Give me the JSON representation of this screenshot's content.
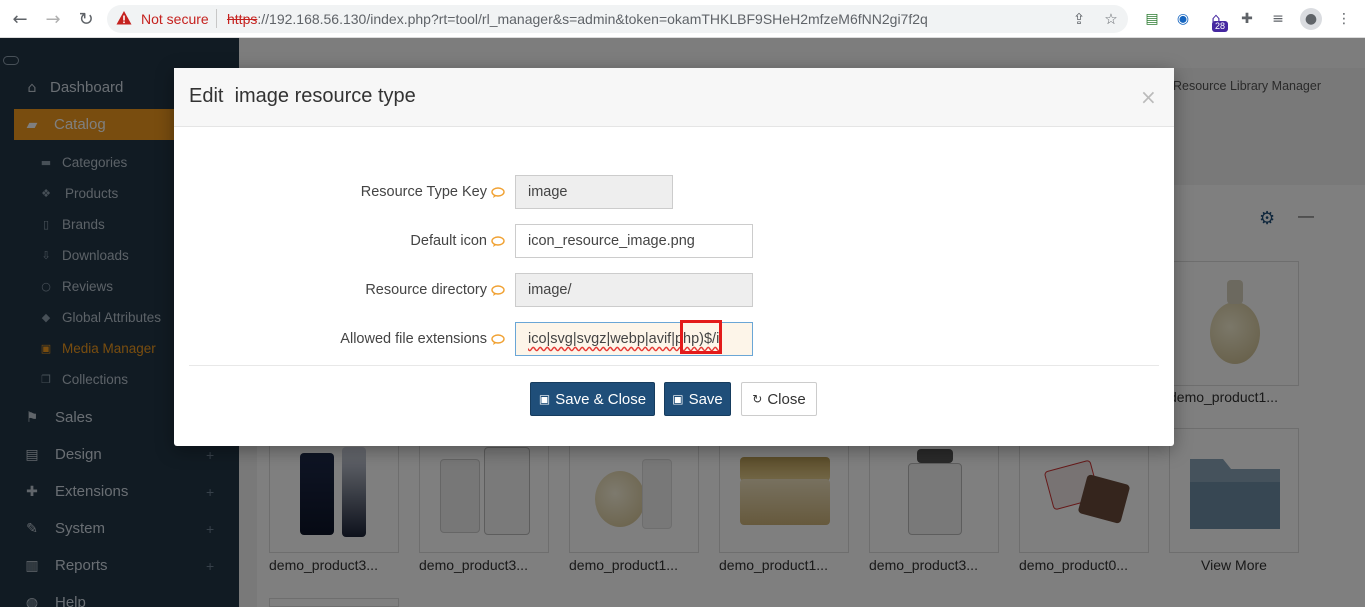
{
  "browser": {
    "back_icon": "back-arrow-icon",
    "forward_icon": "forward-arrow-icon",
    "reload_icon": "reload-icon",
    "not_secure_label": "Not secure",
    "url_scheme": "https",
    "url_rest": "://192.168.56.130/index.php?rt=tool/rl_manager&s=admin&token=okamTHKLBF9SHeH2mfzeM6fNN2gi7f2q",
    "extension_badge": "28"
  },
  "sidebar": {
    "items": [
      {
        "label": "Dashboard",
        "icon": "home-icon"
      },
      {
        "label": "Catalog",
        "icon": "folder-open-icon"
      },
      {
        "label": "Sales",
        "icon": "flag-icon"
      },
      {
        "label": "Design",
        "icon": "file-icon"
      },
      {
        "label": "Extensions",
        "icon": "puzzle-icon"
      },
      {
        "label": "System",
        "icon": "wrench-icon"
      },
      {
        "label": "Reports",
        "icon": "bar-chart-icon"
      },
      {
        "label": "Help",
        "icon": "globe-icon"
      }
    ],
    "sub_items": [
      {
        "label": "Categories",
        "icon": "folder-icon"
      },
      {
        "label": "Products",
        "icon": "cubes-icon"
      },
      {
        "label": "Brands",
        "icon": "bookmark-icon"
      },
      {
        "label": "Downloads",
        "icon": "download-icon"
      },
      {
        "label": "Reviews",
        "icon": "comment-icon"
      },
      {
        "label": "Global Attributes",
        "icon": "tag-icon"
      },
      {
        "label": "Media Manager",
        "icon": "image-icon"
      },
      {
        "label": "Collections",
        "icon": "copy-icon"
      }
    ],
    "plus": "+"
  },
  "page": {
    "breadcrumb_right": "Resource Library Manager"
  },
  "gallery": {
    "top_caption": "demo_product1...",
    "captions": [
      "demo_product3...",
      "demo_product3...",
      "demo_product1...",
      "demo_product1...",
      "demo_product3...",
      "demo_product0...",
      "View More"
    ]
  },
  "modal": {
    "title": "Edit  image resource type",
    "close_glyph": "×",
    "fields": [
      {
        "label": "Resource Type Key",
        "value": "image"
      },
      {
        "label": "Default icon",
        "value": "icon_resource_image.png"
      },
      {
        "label": "Resource directory",
        "value": "image/"
      },
      {
        "label": "Allowed file extensions",
        "value": "ico|svg|svgz|webp|avif|php)$/i"
      }
    ],
    "buttons": {
      "save_close": "Save & Close",
      "save": "Save",
      "close": "Close"
    }
  },
  "colors": {
    "sidebar_bg": "#233647",
    "accent_orange": "#f29b1e",
    "primary_button": "#1f4e79",
    "highlight_red": "#e31b1b"
  }
}
